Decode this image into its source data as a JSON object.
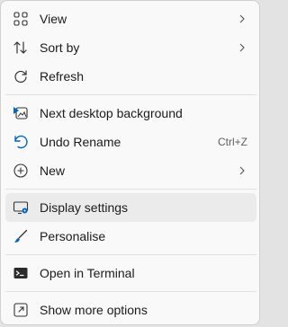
{
  "menu": {
    "items": [
      {
        "label": "View",
        "icon": "grid-view-icon",
        "submenu": true
      },
      {
        "label": "Sort by",
        "icon": "sort-arrows-icon",
        "submenu": true
      },
      {
        "label": "Refresh",
        "icon": "refresh-icon"
      },
      {
        "label": "Next desktop background",
        "icon": "desktop-background-next-icon"
      },
      {
        "label": "Undo Rename",
        "icon": "undo-icon",
        "shortcut": "Ctrl+Z"
      },
      {
        "label": "New",
        "icon": "new-plus-icon",
        "submenu": true
      },
      {
        "label": "Display settings",
        "icon": "display-settings-icon",
        "highlighted": true
      },
      {
        "label": "Personalise",
        "icon": "brush-icon"
      },
      {
        "label": "Open in Terminal",
        "icon": "terminal-icon"
      },
      {
        "label": "Show more options",
        "icon": "share-more-icon"
      }
    ]
  },
  "colors": {
    "background": "#f9f9f9",
    "hover": "#ebebeb",
    "accent": "#0067c0",
    "text": "#1b1b1b"
  }
}
